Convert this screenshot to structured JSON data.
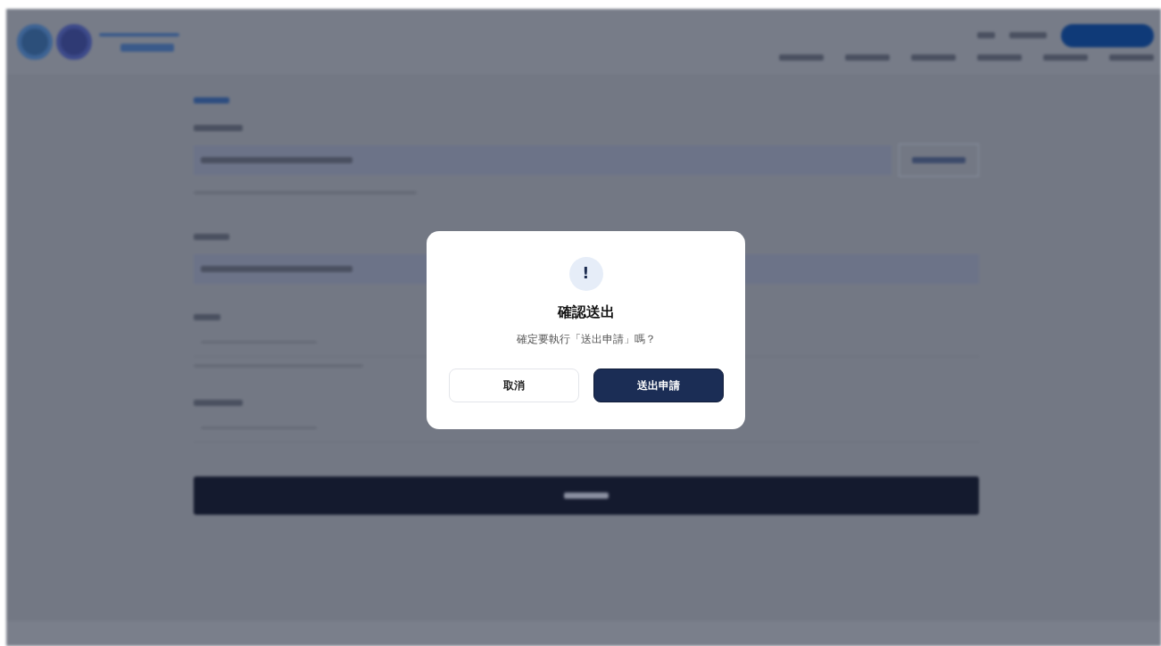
{
  "dialog": {
    "icon": "!",
    "title": "確認送出",
    "message": "確定要執行「送出申請」嗎？",
    "buttons": [
      {
        "label": "取消",
        "kind": "secondary"
      },
      {
        "label": "送出申請",
        "kind": "primary"
      }
    ]
  }
}
